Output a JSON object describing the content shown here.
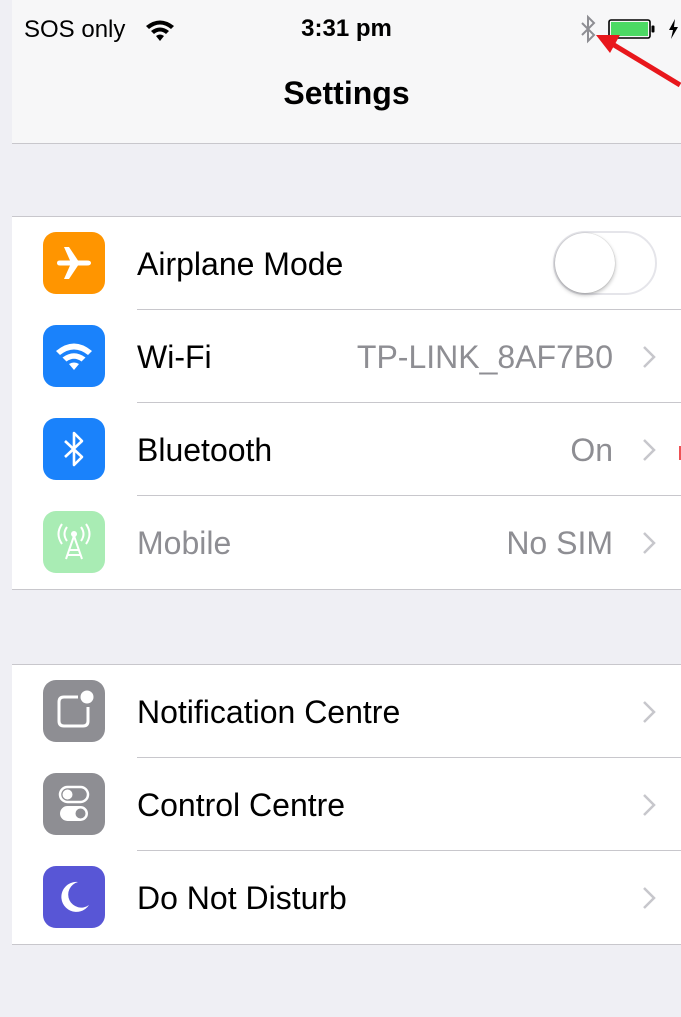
{
  "status_bar": {
    "carrier": "SOS only",
    "time": "3:31 pm",
    "battery_level": 1.0,
    "battery_color": "#4cd964"
  },
  "nav": {
    "title": "Settings"
  },
  "groups": [
    {
      "rows": [
        {
          "label": "Airplane Mode",
          "icon": "airplane-icon",
          "icon_color": "#ff9500",
          "control": "toggle",
          "toggle_on": false
        },
        {
          "label": "Wi-Fi",
          "detail": "TP-LINK_8AF7B0",
          "icon": "wifi-icon",
          "icon_color": "#1a82fb"
        },
        {
          "label": "Bluetooth",
          "detail": "On",
          "icon": "bluetooth-icon",
          "icon_color": "#1a82fb"
        },
        {
          "label": "Mobile",
          "detail": "No SIM",
          "icon": "cellular-antenna-icon",
          "icon_color": "#a9ecb4",
          "disabled": true
        }
      ]
    },
    {
      "rows": [
        {
          "label": "Notification Centre",
          "icon": "notification-centre-icon",
          "icon_color": "#8e8e93"
        },
        {
          "label": "Control Centre",
          "icon": "control-centre-icon",
          "icon_color": "#8e8e93"
        },
        {
          "label": "Do Not Disturb",
          "icon": "moon-icon",
          "icon_color": "#5856d6"
        }
      ]
    }
  ],
  "annotation_color": "#e8171c"
}
